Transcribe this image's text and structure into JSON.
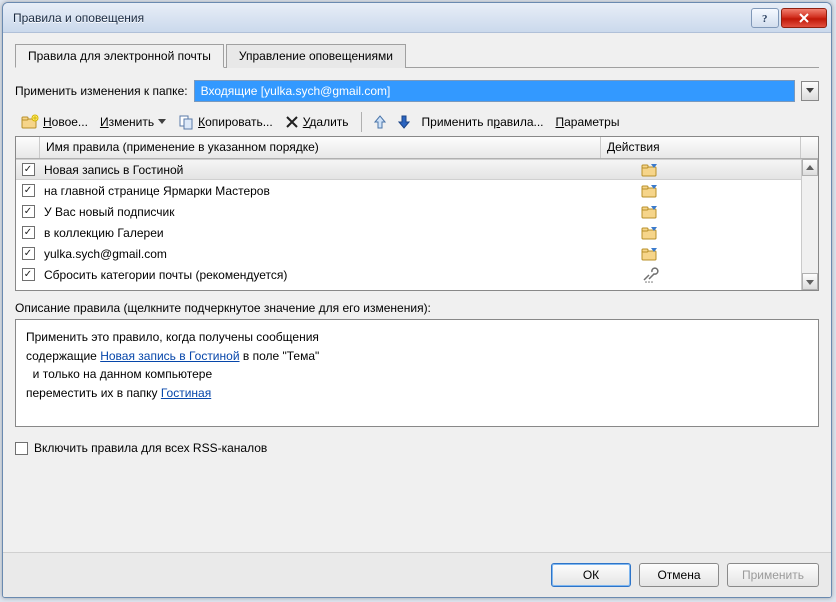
{
  "window": {
    "title": "Правила и оповещения"
  },
  "tabs": {
    "rules": "Правила для электронной почты",
    "alerts": "Управление оповещениями"
  },
  "apply_to": {
    "label": "Применить изменения к папке:",
    "value": "Входящие [yulka.sych@gmail.com]"
  },
  "toolbar": {
    "new": "Новое...",
    "change": "Изменить",
    "copy": "Копировать...",
    "delete": "Удалить",
    "run": "Применить правила...",
    "options": "Параметры"
  },
  "grid": {
    "col_name": "Имя правила (применение в указанном порядке)",
    "col_actions": "Действия",
    "rows": [
      {
        "name": "Новая запись в Гостиной",
        "icon": "move-folder",
        "selected": true
      },
      {
        "name": "на главной странице Ярмарки Мастеров",
        "icon": "move-folder",
        "selected": false
      },
      {
        "name": "У Вас новый подписчик",
        "icon": "move-folder",
        "selected": false
      },
      {
        "name": " в коллекцию Галереи",
        "icon": "move-folder",
        "selected": false
      },
      {
        "name": "yulka.sych@gmail.com",
        "icon": "move-folder",
        "selected": false
      },
      {
        "name": "Сбросить категории почты (рекомендуется)",
        "icon": "clear-cats",
        "selected": false
      }
    ]
  },
  "description": {
    "label": "Описание правила (щелкните подчеркнутое значение для его изменения):",
    "line1": "Применить это правило, когда получены сообщения",
    "line2_prefix": "содержащие ",
    "line2_link": "Новая запись в Гостиной",
    "line2_suffix": " в поле \"Тема\"",
    "line3": "  и только на данном компьютере",
    "line4_prefix": "переместить их в папку ",
    "line4_link": "Гостиная"
  },
  "rss": {
    "label": "Включить правила для всех RSS-каналов"
  },
  "footer": {
    "ok": "ОК",
    "cancel": "Отмена",
    "apply": "Применить"
  }
}
